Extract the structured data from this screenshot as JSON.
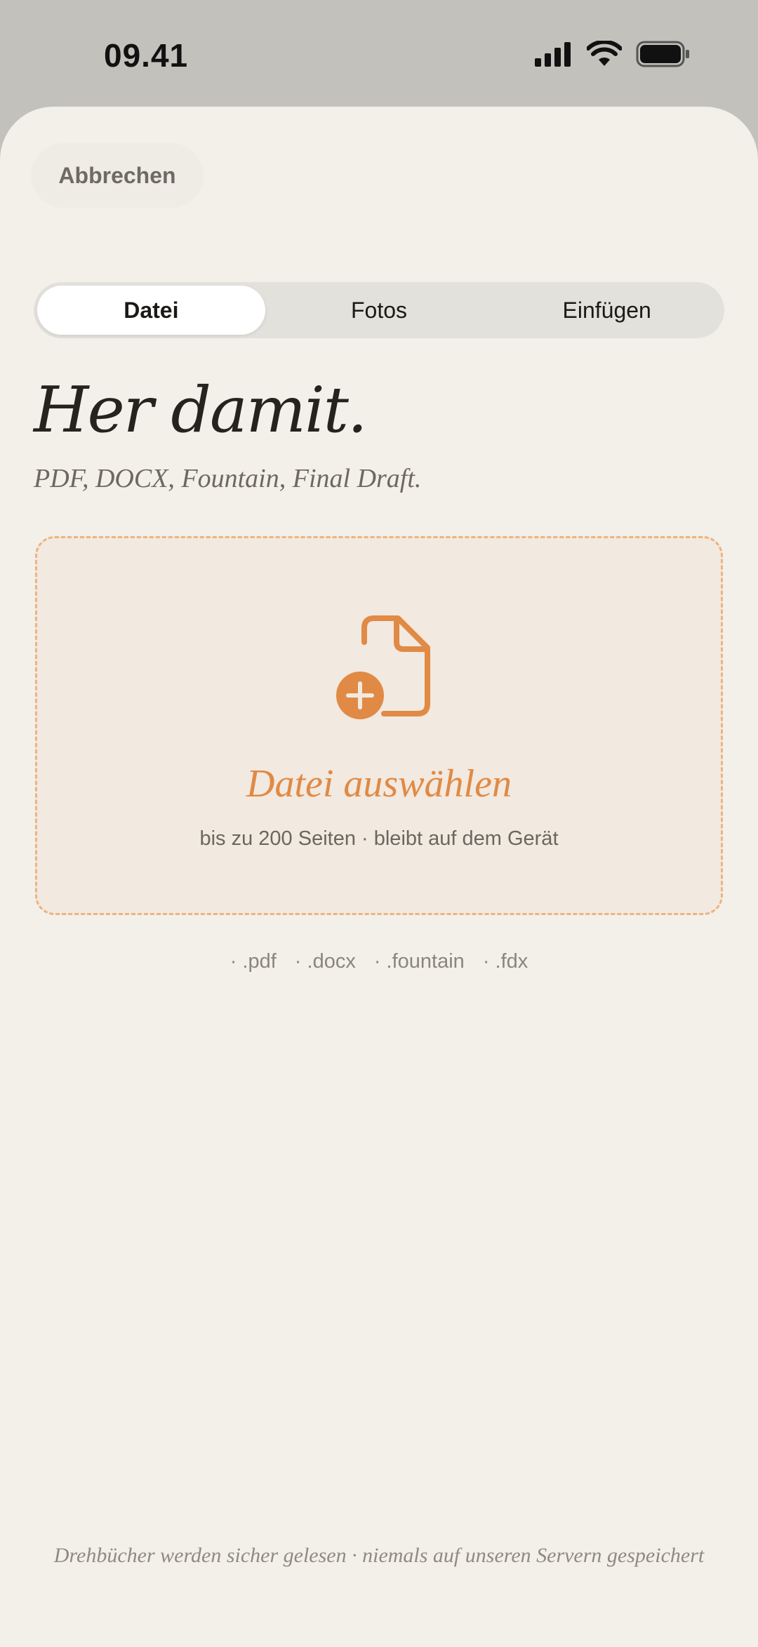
{
  "status_bar": {
    "time": "09.41",
    "icons": [
      "signal-icon",
      "wifi-icon",
      "battery-icon"
    ]
  },
  "header": {
    "cancel_label": "Abbrechen"
  },
  "tabs": [
    {
      "label": "Datei",
      "active": true
    },
    {
      "label": "Fotos",
      "active": false
    },
    {
      "label": "Einfügen",
      "active": false
    }
  ],
  "main": {
    "headline": "Her damit.",
    "subhead": "PDF, DOCX, Fountain, Final Draft."
  },
  "dropzone": {
    "icon": "file-add-icon",
    "title": "Datei auswählen",
    "subtitle": "bis zu 200 Seiten · bleibt auf dem Gerät"
  },
  "formats": [
    "· .pdf",
    "· .docx",
    "· .fountain",
    "· .fdx"
  ],
  "footer": {
    "note": "Drehbücher werden sicher gelesen · niemals auf unseren Servern gespeichert"
  },
  "colors": {
    "accent": "#e08a45",
    "background": "#f3f0ea",
    "dropzone_bg": "#f2e9e0",
    "dropzone_border": "#ecb47f"
  }
}
